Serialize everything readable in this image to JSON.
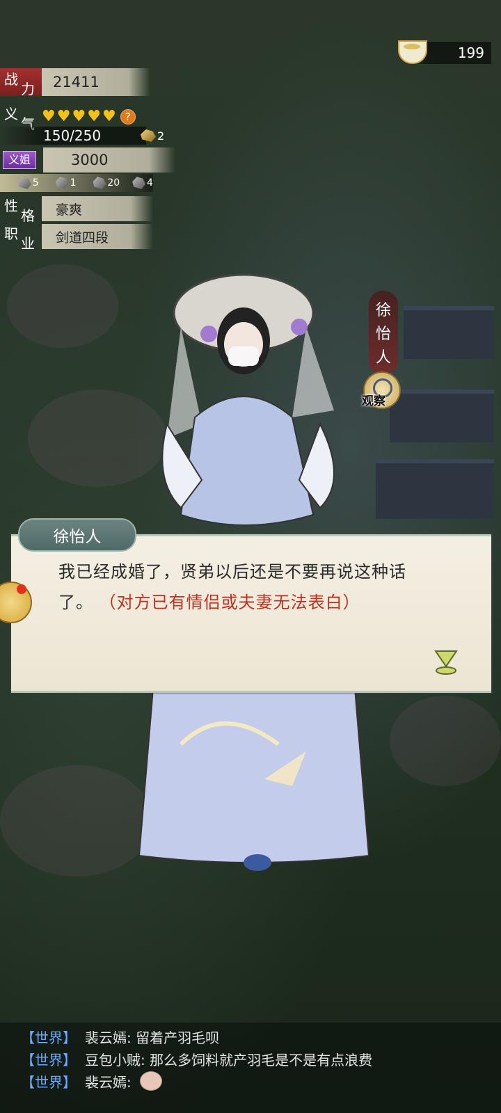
{
  "currency": {
    "icon": "bowl-icon",
    "value": "199"
  },
  "stats": {
    "power": {
      "label_1": "战",
      "label_2": "力",
      "value": "21411"
    },
    "loyalty": {
      "label_1": "义",
      "label_2": "气",
      "hearts": 5,
      "progress_text": "150/250",
      "item_count": "2"
    },
    "sister": {
      "badge": "义姐",
      "value": "3000"
    },
    "gifts": [
      {
        "count": "5"
      },
      {
        "count": "1"
      },
      {
        "count": "20"
      },
      {
        "count": "4"
      }
    ],
    "personality": {
      "label_1": "性",
      "label_2": "格",
      "value": "豪爽"
    },
    "profession": {
      "label_1": "职",
      "label_2": "业",
      "value": "剑道四段"
    }
  },
  "npc": {
    "name_chars": [
      "徐",
      "怡",
      "人"
    ],
    "observe_label": "观察"
  },
  "dialog": {
    "speaker": "徐怡人",
    "text": "我已经成婚了，贤弟以后还是不要再说这种话了。",
    "note": "（对方已有情侣或夫妻无法表白）"
  },
  "chat": [
    {
      "channel": "【世界】",
      "message": "裴云嫣: 留着产羽毛呗"
    },
    {
      "channel": "【世界】",
      "message": "豆包小贼: 那么多饲料就产羽毛是不是有点浪费"
    },
    {
      "channel": "【世界】",
      "message": "裴云嫣: "
    }
  ],
  "colors": {
    "accent_red": "#c0301e",
    "channel_blue": "#6fa8ff",
    "heart_gold": "#f3c21a"
  }
}
